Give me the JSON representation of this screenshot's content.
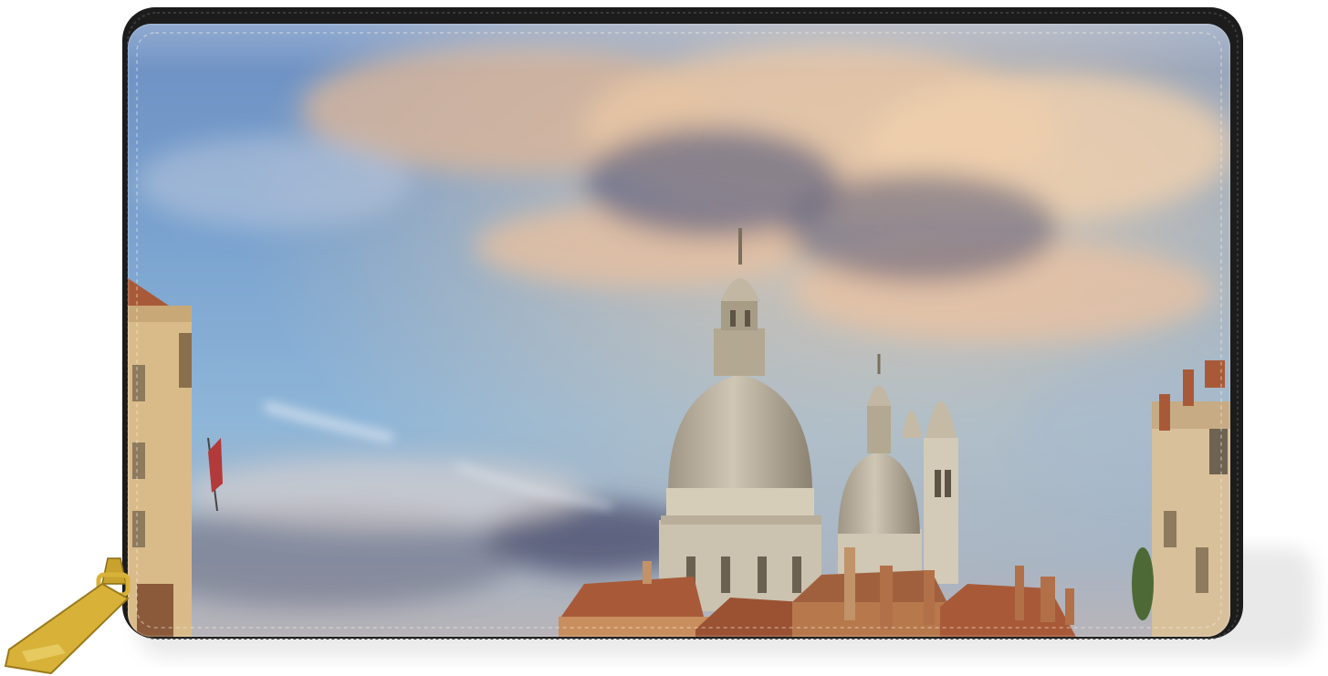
{
  "image": {
    "subject": "zip-around-wallet",
    "print": "venice-basilica-sunset-sky"
  },
  "colors": {
    "background": "#ffffff",
    "zipper": "#1c1c1c",
    "zipper_pull": "#d8b238",
    "sky_blue": "#5f93c8",
    "cloud_warm": "#e9c7a4",
    "cloud_dark": "#4c506e",
    "dome_stone": "#b9b09e",
    "roof_terracotta": "#a85a38",
    "building_facade": "#d9bb8a"
  }
}
